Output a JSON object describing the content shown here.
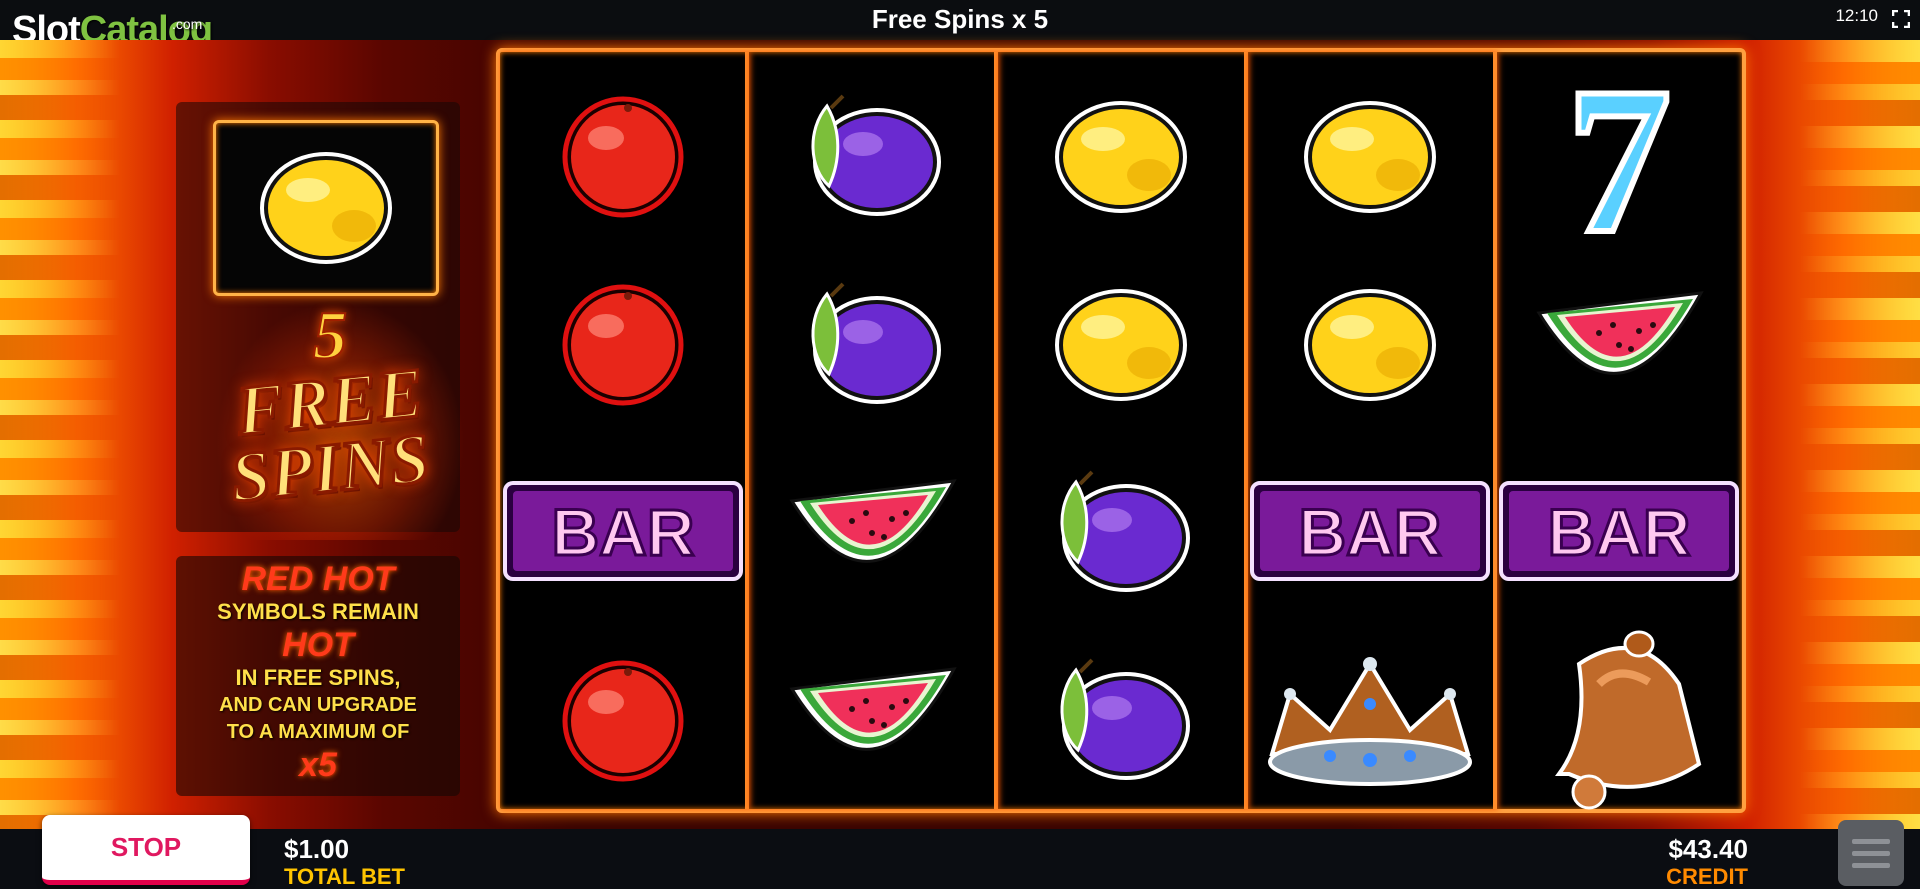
{
  "brand": {
    "slot": "Slot",
    "catalog": "Catalog",
    "com": ".com"
  },
  "header": {
    "title": "Free Spins x 5",
    "clock": "12:10"
  },
  "panel": {
    "featured_symbol": "lemon",
    "free_spins_count": "5",
    "free_spins_word_1": "FREE",
    "free_spins_word_2": "SPINS",
    "info": {
      "line1": "RED HOT",
      "line2": "SYMBOLS REMAIN",
      "line3": "HOT",
      "line4": "IN FREE SPINS,",
      "line5": "AND CAN UPGRADE",
      "line6": "TO A MAXIMUM OF",
      "line7": "x5"
    }
  },
  "reels": [
    [
      "cherry",
      "cherry",
      "bar",
      "cherry"
    ],
    [
      "plum",
      "plum",
      "watermelon",
      "watermelon"
    ],
    [
      "lemon",
      "lemon",
      "plum",
      "plum"
    ],
    [
      "lemon",
      "lemon",
      "bar",
      "crown"
    ],
    [
      "seven",
      "watermelon",
      "bar",
      "bell"
    ]
  ],
  "symbol_text": {
    "bar": "BAR",
    "seven": "7"
  },
  "controls": {
    "stop_label": "STOP",
    "total_bet_amount": "$1.00",
    "total_bet_label": "TOTAL BET",
    "credit_amount": "$43.40",
    "credit_label": "CREDIT"
  },
  "colors": {
    "frame": "#ffa040",
    "accent_red": "#e01860",
    "credit_orange": "#ff8a00",
    "bet_yellow": "#ffc400"
  }
}
